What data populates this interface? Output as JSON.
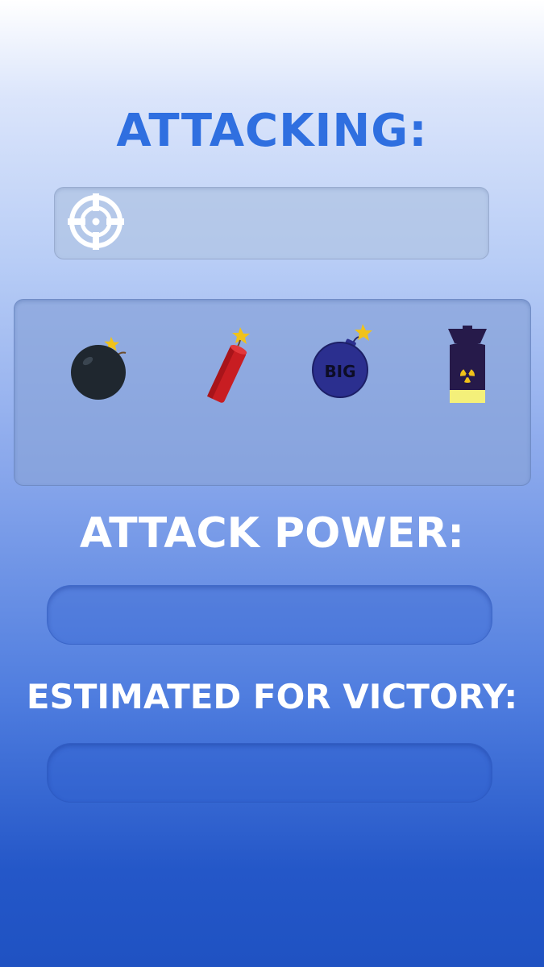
{
  "titles": {
    "attacking": "ATTACKING:",
    "attack_power": "ATTACK POWER:",
    "estimated_victory": "ESTIMATED FOR VICTORY:"
  },
  "target": {
    "icon": "crosshair-icon",
    "value": ""
  },
  "weapons": [
    {
      "icon": "bomb-icon"
    },
    {
      "icon": "dynamite-icon"
    },
    {
      "icon": "big-bomb-icon",
      "label": "BIG"
    },
    {
      "icon": "nuke-icon"
    }
  ],
  "attack_power": {
    "value": ""
  },
  "estimated_for_victory": {
    "value": ""
  },
  "colors": {
    "title_blue": "#2f6fe0",
    "bomb": "#1f272f",
    "dynamite": "#c81d22",
    "big_bomb": "#2b2f8f",
    "nuke_body": "#261a4a",
    "nuke_glow": "#f4f07a",
    "spark": "#f0c21a"
  }
}
